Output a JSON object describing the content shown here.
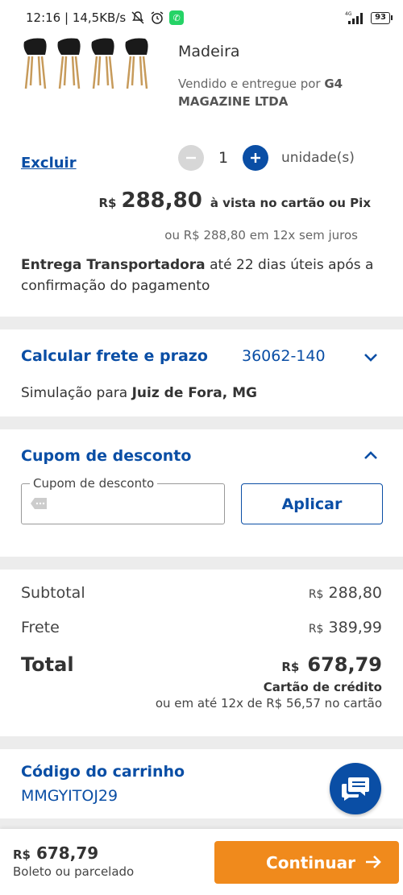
{
  "status_bar": {
    "time_speed": "12:16 | 14,5KB/s",
    "network": "4G",
    "battery": "93",
    "icons": [
      "notifications-off-icon",
      "alarm-icon",
      "whatsapp-icon",
      "signal-icon",
      "battery-icon"
    ]
  },
  "product": {
    "name": "Eames Dsw Preta Base Madeira",
    "seller_prefix": "Vendido e entregue por",
    "seller_name": "G4 MAGAZINE LTDA",
    "remove_label": "Excluir",
    "quantity": "1",
    "quantity_unit": "unidade(s)",
    "price_currency": "R$",
    "price_value": "288,80",
    "price_condition": "à vista no cartão ou Pix",
    "installments": "ou R$ 288,80 em 12x sem juros",
    "delivery_method": "Entrega Transportadora",
    "delivery_time": "até 22 dias úteis após a confirmação do pagamento"
  },
  "freight": {
    "title": "Calcular frete e prazo",
    "cep": "36062-140",
    "simulation_prefix": "Simulação para",
    "simulation_city": "Juiz de Fora, MG"
  },
  "coupon": {
    "title": "Cupom de desconto",
    "field_label": "Cupom de desconto",
    "input_value": "",
    "apply_label": "Aplicar"
  },
  "summary": {
    "subtotal_label": "Subtotal",
    "subtotal_currency": "R$",
    "subtotal_value": "288,80",
    "freight_label": "Frete",
    "freight_currency": "R$",
    "freight_value": "389,99",
    "total_label": "Total",
    "total_currency": "R$",
    "total_value": "678,79",
    "payment_method": "Cartão de crédito",
    "payment_installments": "ou em até 12x de R$ 56,57 no cartão"
  },
  "cart_code": {
    "title": "Código do carrinho",
    "value": "MMGYITOJ29"
  },
  "bottom_bar": {
    "currency": "R$",
    "price": "678,79",
    "subtitle": "Boleto ou parcelado",
    "continue_label": "Continuar"
  },
  "colors": {
    "brand_blue": "#0a4ea5",
    "cta_orange": "#f08a1c",
    "background": "#ececec"
  }
}
